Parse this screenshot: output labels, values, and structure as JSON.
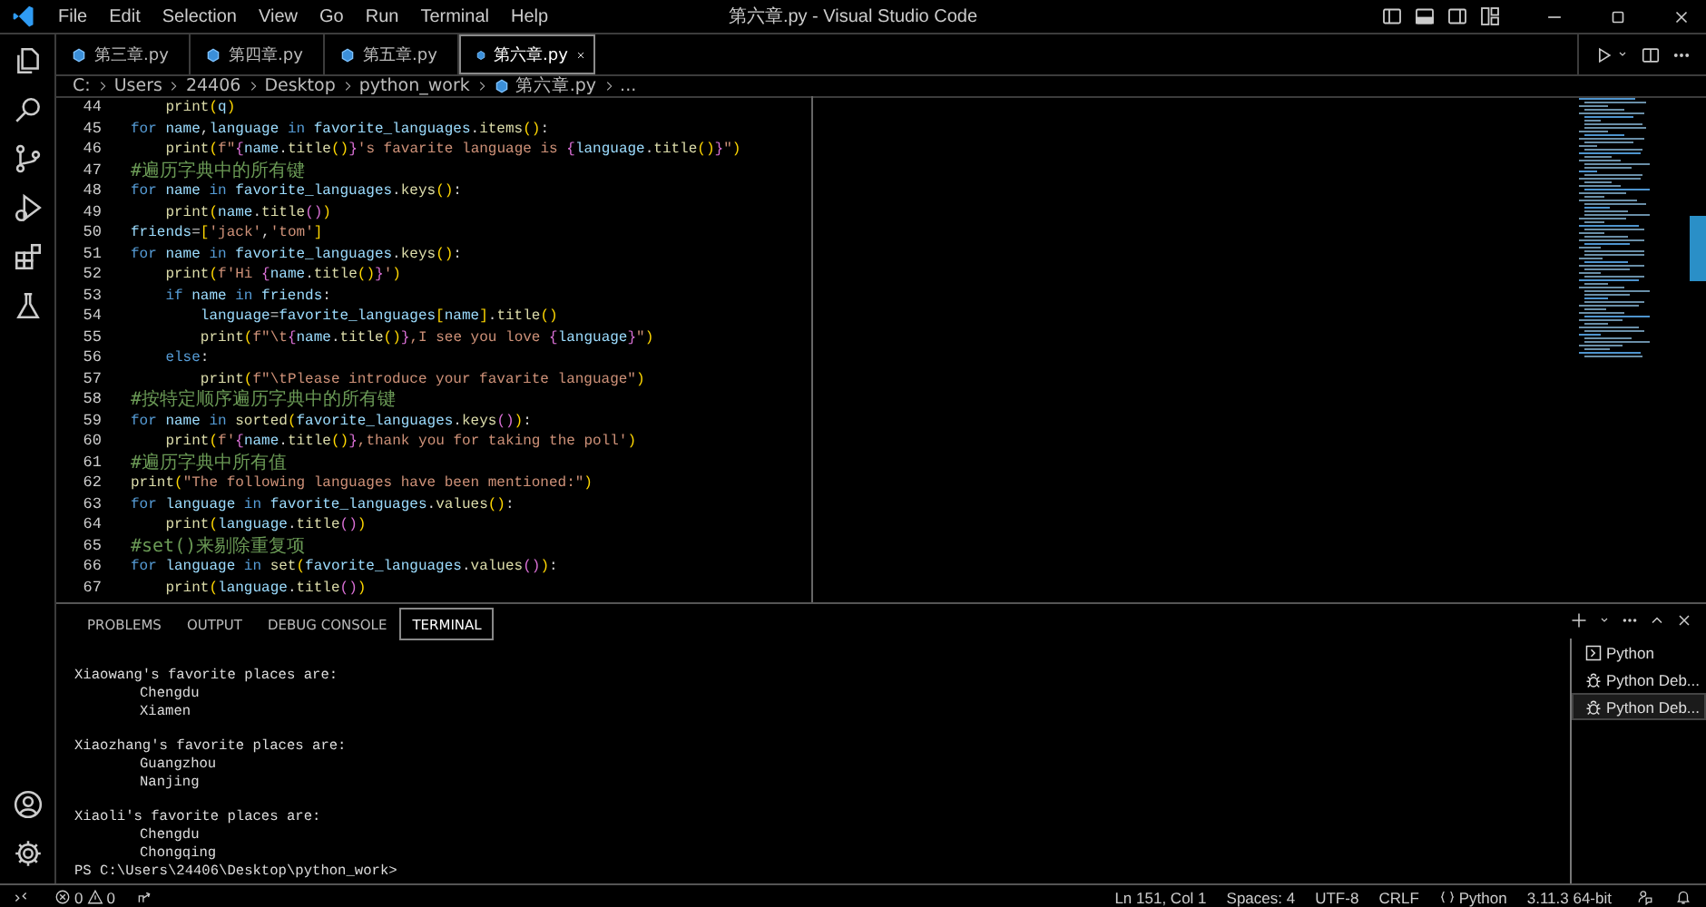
{
  "window": {
    "title": "第六章.py - Visual Studio Code"
  },
  "menu": [
    "File",
    "Edit",
    "Selection",
    "View",
    "Go",
    "Run",
    "Terminal",
    "Help"
  ],
  "tabs": [
    {
      "label": "第三章.py",
      "selected": false
    },
    {
      "label": "第四章.py",
      "selected": false
    },
    {
      "label": "第五章.py",
      "selected": false
    },
    {
      "label": "第六章.py",
      "selected": true
    }
  ],
  "breadcrumb": [
    {
      "label": "C:",
      "kind": "folder"
    },
    {
      "label": "Users",
      "kind": "folder"
    },
    {
      "label": "24406",
      "kind": "folder"
    },
    {
      "label": "Desktop",
      "kind": "folder"
    },
    {
      "label": "python_work",
      "kind": "folder"
    },
    {
      "label": "第六章.py",
      "kind": "file"
    },
    {
      "label": "...",
      "kind": "folder"
    }
  ],
  "code": [
    {
      "number": "44",
      "tokens": [
        {
          "text": "    print",
          "kind": "function"
        },
        {
          "text": "(",
          "kind": "bracket"
        },
        {
          "text": "q",
          "kind": "name"
        },
        {
          "text": ")",
          "kind": "bracket"
        }
      ]
    },
    {
      "number": "45",
      "tokens": [
        {
          "text": "for",
          "kind": "keyword"
        },
        {
          "text": " name",
          "kind": "name"
        },
        {
          "text": ",",
          "kind": "punct"
        },
        {
          "text": "language",
          "kind": "name"
        },
        {
          "text": " in ",
          "kind": "keyword"
        },
        {
          "text": "favorite_languages",
          "kind": "name"
        },
        {
          "text": ".",
          "kind": "punct"
        },
        {
          "text": "items",
          "kind": "function"
        },
        {
          "text": "()",
          "kind": "bracket"
        },
        {
          "text": ":",
          "kind": "punct"
        }
      ]
    },
    {
      "number": "46",
      "tokens": [
        {
          "text": "    print",
          "kind": "function"
        },
        {
          "text": "(",
          "kind": "bracket"
        },
        {
          "text": "f\"",
          "kind": "string"
        },
        {
          "text": "{",
          "kind": "brace"
        },
        {
          "text": "name",
          "kind": "name"
        },
        {
          "text": ".",
          "kind": "punct"
        },
        {
          "text": "title",
          "kind": "function"
        },
        {
          "text": "()",
          "kind": "bracket"
        },
        {
          "text": "}",
          "kind": "brace"
        },
        {
          "text": "'s favarite language is ",
          "kind": "string"
        },
        {
          "text": "{",
          "kind": "brace"
        },
        {
          "text": "language",
          "kind": "name"
        },
        {
          "text": ".",
          "kind": "punct"
        },
        {
          "text": "title",
          "kind": "function"
        },
        {
          "text": "()",
          "kind": "bracket"
        },
        {
          "text": "}",
          "kind": "brace"
        },
        {
          "text": "\"",
          "kind": "string"
        },
        {
          "text": ")",
          "kind": "bracket"
        }
      ]
    },
    {
      "number": "47",
      "tokens": [
        {
          "text": "#遍历字典中的所有键",
          "kind": "comment"
        }
      ]
    },
    {
      "number": "48",
      "tokens": [
        {
          "text": "for",
          "kind": "keyword"
        },
        {
          "text": " name",
          "kind": "name"
        },
        {
          "text": " in ",
          "kind": "keyword"
        },
        {
          "text": "favorite_languages",
          "kind": "name"
        },
        {
          "text": ".",
          "kind": "punct"
        },
        {
          "text": "keys",
          "kind": "function"
        },
        {
          "text": "()",
          "kind": "bracket"
        },
        {
          "text": ":",
          "kind": "punct"
        }
      ]
    },
    {
      "number": "49",
      "tokens": [
        {
          "text": "    print",
          "kind": "function"
        },
        {
          "text": "(",
          "kind": "bracket"
        },
        {
          "text": "name",
          "kind": "name"
        },
        {
          "text": ".",
          "kind": "punct"
        },
        {
          "text": "title",
          "kind": "function"
        },
        {
          "text": "()",
          "kind": "brace"
        },
        {
          "text": ")",
          "kind": "bracket"
        }
      ]
    },
    {
      "number": "50",
      "tokens": [
        {
          "text": "friends",
          "kind": "name"
        },
        {
          "text": "=",
          "kind": "punct"
        },
        {
          "text": "[",
          "kind": "bracket"
        },
        {
          "text": "'jack'",
          "kind": "string"
        },
        {
          "text": ",",
          "kind": "punct"
        },
        {
          "text": "'tom'",
          "kind": "string"
        },
        {
          "text": "]",
          "kind": "bracket"
        }
      ]
    },
    {
      "number": "51",
      "tokens": [
        {
          "text": "for",
          "kind": "keyword"
        },
        {
          "text": " name",
          "kind": "name"
        },
        {
          "text": " in ",
          "kind": "keyword"
        },
        {
          "text": "favorite_languages",
          "kind": "name"
        },
        {
          "text": ".",
          "kind": "punct"
        },
        {
          "text": "keys",
          "kind": "function"
        },
        {
          "text": "()",
          "kind": "bracket"
        },
        {
          "text": ":",
          "kind": "punct"
        }
      ]
    },
    {
      "number": "52",
      "tokens": [
        {
          "text": "    print",
          "kind": "function"
        },
        {
          "text": "(",
          "kind": "bracket"
        },
        {
          "text": "f'Hi ",
          "kind": "string"
        },
        {
          "text": "{",
          "kind": "brace"
        },
        {
          "text": "name",
          "kind": "name"
        },
        {
          "text": ".",
          "kind": "punct"
        },
        {
          "text": "title",
          "kind": "function"
        },
        {
          "text": "()",
          "kind": "bracket"
        },
        {
          "text": "}",
          "kind": "brace"
        },
        {
          "text": "'",
          "kind": "string"
        },
        {
          "text": ")",
          "kind": "bracket"
        }
      ]
    },
    {
      "number": "53",
      "tokens": [
        {
          "text": "    if",
          "kind": "keyword"
        },
        {
          "text": " name",
          "kind": "name"
        },
        {
          "text": " in ",
          "kind": "keyword"
        },
        {
          "text": "friends",
          "kind": "name"
        },
        {
          "text": ":",
          "kind": "punct"
        }
      ]
    },
    {
      "number": "54",
      "tokens": [
        {
          "text": "        language",
          "kind": "name"
        },
        {
          "text": "=",
          "kind": "punct"
        },
        {
          "text": "favorite_languages",
          "kind": "name"
        },
        {
          "text": "[",
          "kind": "bracket"
        },
        {
          "text": "name",
          "kind": "name"
        },
        {
          "text": "]",
          "kind": "bracket"
        },
        {
          "text": ".",
          "kind": "punct"
        },
        {
          "text": "title",
          "kind": "function"
        },
        {
          "text": "()",
          "kind": "bracket"
        }
      ]
    },
    {
      "number": "55",
      "tokens": [
        {
          "text": "        print",
          "kind": "function"
        },
        {
          "text": "(",
          "kind": "bracket"
        },
        {
          "text": "f\"\\t",
          "kind": "string"
        },
        {
          "text": "{",
          "kind": "brace"
        },
        {
          "text": "name",
          "kind": "name"
        },
        {
          "text": ".",
          "kind": "punct"
        },
        {
          "text": "title",
          "kind": "function"
        },
        {
          "text": "()",
          "kind": "bracket"
        },
        {
          "text": "}",
          "kind": "brace"
        },
        {
          "text": ",I see you love ",
          "kind": "string"
        },
        {
          "text": "{",
          "kind": "brace"
        },
        {
          "text": "language",
          "kind": "name"
        },
        {
          "text": "}",
          "kind": "brace"
        },
        {
          "text": "\"",
          "kind": "string"
        },
        {
          "text": ")",
          "kind": "bracket"
        }
      ]
    },
    {
      "number": "56",
      "tokens": [
        {
          "text": "    else",
          "kind": "keyword"
        },
        {
          "text": ":",
          "kind": "punct"
        }
      ]
    },
    {
      "number": "57",
      "tokens": [
        {
          "text": "        print",
          "kind": "function"
        },
        {
          "text": "(",
          "kind": "bracket"
        },
        {
          "text": "f\"\\tPlease introduce your favarite language\"",
          "kind": "string"
        },
        {
          "text": ")",
          "kind": "bracket"
        }
      ]
    },
    {
      "number": "58",
      "tokens": [
        {
          "text": "#按特定顺序遍历字典中的所有键",
          "kind": "comment"
        }
      ]
    },
    {
      "number": "59",
      "tokens": [
        {
          "text": "for",
          "kind": "keyword"
        },
        {
          "text": " name",
          "kind": "name"
        },
        {
          "text": " in ",
          "kind": "keyword"
        },
        {
          "text": "sorted",
          "kind": "function"
        },
        {
          "text": "(",
          "kind": "bracket"
        },
        {
          "text": "favorite_languages",
          "kind": "name"
        },
        {
          "text": ".",
          "kind": "punct"
        },
        {
          "text": "keys",
          "kind": "function"
        },
        {
          "text": "()",
          "kind": "brace"
        },
        {
          "text": ")",
          "kind": "bracket"
        },
        {
          "text": ":",
          "kind": "punct"
        }
      ]
    },
    {
      "number": "60",
      "tokens": [
        {
          "text": "    print",
          "kind": "function"
        },
        {
          "text": "(",
          "kind": "bracket"
        },
        {
          "text": "f'",
          "kind": "string"
        },
        {
          "text": "{",
          "kind": "brace"
        },
        {
          "text": "name",
          "kind": "name"
        },
        {
          "text": ".",
          "kind": "punct"
        },
        {
          "text": "title",
          "kind": "function"
        },
        {
          "text": "()",
          "kind": "bracket"
        },
        {
          "text": "}",
          "kind": "brace"
        },
        {
          "text": ",thank you for taking the poll'",
          "kind": "string"
        },
        {
          "text": ")",
          "kind": "bracket"
        }
      ]
    },
    {
      "number": "61",
      "tokens": [
        {
          "text": "#遍历字典中所有值",
          "kind": "comment"
        }
      ]
    },
    {
      "number": "62",
      "tokens": [
        {
          "text": "print",
          "kind": "function"
        },
        {
          "text": "(",
          "kind": "bracket"
        },
        {
          "text": "\"The following languages have been mentioned:\"",
          "kind": "string"
        },
        {
          "text": ")",
          "kind": "bracket"
        }
      ]
    },
    {
      "number": "63",
      "tokens": [
        {
          "text": "for",
          "kind": "keyword"
        },
        {
          "text": " language",
          "kind": "name"
        },
        {
          "text": " in ",
          "kind": "keyword"
        },
        {
          "text": "favorite_languages",
          "kind": "name"
        },
        {
          "text": ".",
          "kind": "punct"
        },
        {
          "text": "values",
          "kind": "function"
        },
        {
          "text": "()",
          "kind": "bracket"
        },
        {
          "text": ":",
          "kind": "punct"
        }
      ]
    },
    {
      "number": "64",
      "tokens": [
        {
          "text": "    print",
          "kind": "function"
        },
        {
          "text": "(",
          "kind": "bracket"
        },
        {
          "text": "language",
          "kind": "name"
        },
        {
          "text": ".",
          "kind": "punct"
        },
        {
          "text": "title",
          "kind": "function"
        },
        {
          "text": "()",
          "kind": "brace"
        },
        {
          "text": ")",
          "kind": "bracket"
        }
      ]
    },
    {
      "number": "65",
      "tokens": [
        {
          "text": "#set()来剔除重复项",
          "kind": "comment"
        }
      ]
    },
    {
      "number": "66",
      "tokens": [
        {
          "text": "for",
          "kind": "keyword"
        },
        {
          "text": " language",
          "kind": "name"
        },
        {
          "text": " in ",
          "kind": "keyword"
        },
        {
          "text": "set",
          "kind": "function"
        },
        {
          "text": "(",
          "kind": "bracket"
        },
        {
          "text": "favorite_languages",
          "kind": "name"
        },
        {
          "text": ".",
          "kind": "punct"
        },
        {
          "text": "values",
          "kind": "function"
        },
        {
          "text": "()",
          "kind": "brace"
        },
        {
          "text": ")",
          "kind": "bracket"
        },
        {
          "text": ":",
          "kind": "punct"
        }
      ]
    },
    {
      "number": "67",
      "tokens": [
        {
          "text": "    print",
          "kind": "function"
        },
        {
          "text": "(",
          "kind": "bracket"
        },
        {
          "text": "language",
          "kind": "name"
        },
        {
          "text": ".",
          "kind": "punct"
        },
        {
          "text": "title",
          "kind": "function"
        },
        {
          "text": "()",
          "kind": "brace"
        },
        {
          "text": ")",
          "kind": "bracket"
        }
      ]
    }
  ],
  "panel": {
    "tabs": [
      {
        "label": "PROBLEMS",
        "selected": false
      },
      {
        "label": "OUTPUT",
        "selected": false
      },
      {
        "label": "DEBUG CONSOLE",
        "selected": false
      },
      {
        "label": "TERMINAL",
        "selected": true
      }
    ],
    "output": [
      {
        "heading": "Xiaowang's favorite places are:",
        "items": [
          "Chengdu",
          "Xiamen"
        ]
      },
      {
        "heading": "Xiaozhang's favorite places are:",
        "items": [
          "Guangzhou",
          "Nanjing"
        ]
      },
      {
        "heading": "Xiaoli's favorite places are:",
        "items": [
          "Chengdu",
          "Chongqing"
        ]
      }
    ],
    "prompt": "PS C:\\Users\\24406\\Desktop\\python_work>",
    "terminals": [
      {
        "label": "Python",
        "kind": "shell",
        "selected": false
      },
      {
        "label": "Python Deb...",
        "kind": "debug",
        "selected": false
      },
      {
        "label": "Python Deb...",
        "kind": "debug",
        "selected": true
      }
    ]
  },
  "status_bar": {
    "errors": "0",
    "warnings": "0",
    "items": [
      {
        "text": "Ln 151, Col 1",
        "kind": "plain"
      },
      {
        "text": "Spaces: 4",
        "kind": "plain"
      },
      {
        "text": "UTF-8",
        "kind": "plain"
      },
      {
        "text": "CRLF",
        "kind": "plain"
      },
      {
        "text": "Python",
        "kind": "language"
      },
      {
        "text": "3.11.3 64-bit",
        "kind": "plain"
      }
    ]
  }
}
